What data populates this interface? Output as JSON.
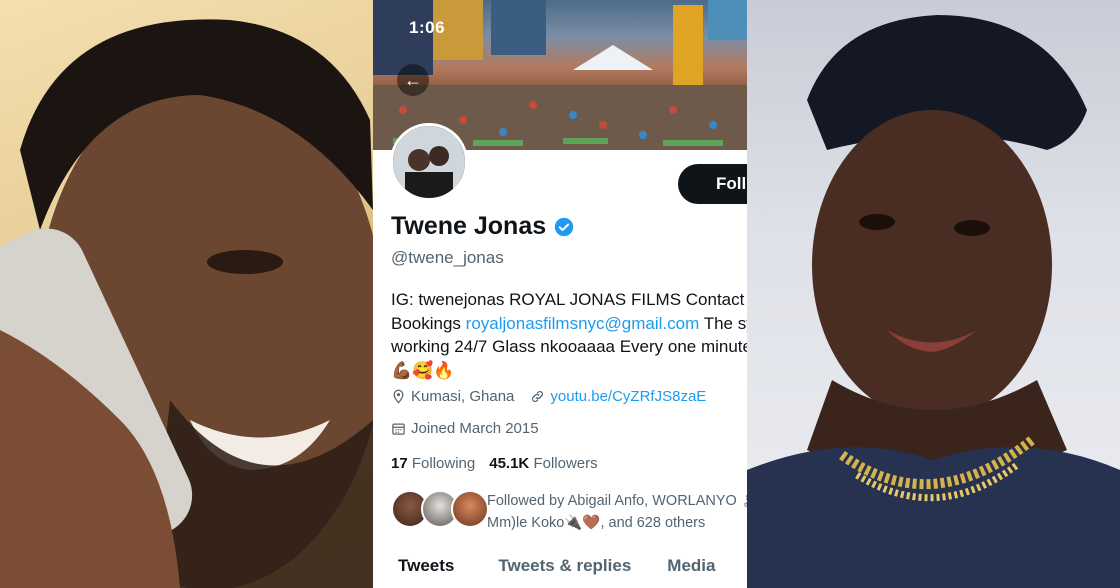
{
  "status_bar": {
    "time": "1:06"
  },
  "profile": {
    "name": "Twene Jonas",
    "handle": "@twene_jonas",
    "follow_label": "Foll",
    "bio": {
      "line1": "IG: twenejonas ROYAL JONAS FILMS Contact u",
      "line2_prefix": "Bookings ",
      "line2_link": "royaljonasfilmsnyc@gmail.com",
      "line2_suffix": " The sy",
      "line3": "working 24/7 Glass nkooaaaa Every one minute",
      "line4": "💪🏾🥰🔥"
    },
    "location": "Kumasi, Ghana",
    "website": "youtu.be/CyZRfJS8zaE",
    "joined": "Joined March 2015",
    "following_count": "17",
    "following_label": "Following",
    "followers_count": "45.1K",
    "followers_label": "Followers",
    "followed_by_line1": "Followed by Abigail Anfo, WORLANYO 🏝",
    "followed_by_line2": "Mm)le Koko🔌🤎, and 628 others"
  },
  "tabs": [
    "Tweets",
    "Tweets & replies",
    "Media"
  ],
  "colors": {
    "accent": "#1d9bf0",
    "text": "#0f1419",
    "muted": "#536471",
    "button": "#0f1419"
  }
}
